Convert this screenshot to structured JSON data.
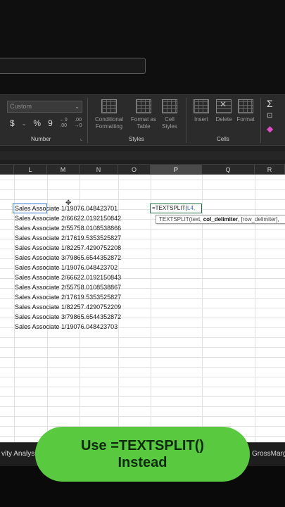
{
  "ribbon": {
    "number_format_value": "Custom",
    "number_buttons": [
      "$",
      "%",
      "9"
    ],
    "groups": {
      "number": "Number",
      "styles": "Styles",
      "cells": "Cells"
    },
    "buttons": {
      "conditional_formatting": [
        "Conditional",
        "Formatting"
      ],
      "format_as_table": [
        "Format as",
        "Table"
      ],
      "cell_styles": [
        "Cell",
        "Styles"
      ],
      "insert": "Insert",
      "delete": "Delete",
      "format": "Format"
    }
  },
  "columns": [
    "L",
    "M",
    "N",
    "O",
    "P",
    "Q",
    "R"
  ],
  "active_column": "P",
  "rows": [
    "Sales Associate 1/19076.048423701",
    "Sales Associate 2/66622.0192150842",
    "Sales Associate 2/55758.0108538866",
    "Sales Associate 2/17619.5353525827",
    "Sales Associate 1/82257.4290752208",
    "Sales Associate 3/79865.6544352872",
    "Sales Associate 1/19076.048423702",
    "Sales Associate 2/66622.0192150843",
    "Sales Associate 2/55758.0108538867",
    "Sales Associate 2/17619.5353525827",
    "Sales Associate 1/82257.4290752209",
    "Sales Associate 3/79865.6544352872",
    "Sales Associate 1/19076.048423703"
  ],
  "formula": {
    "prefix": "=TEXTSPLIT(",
    "ref": "L4,"
  },
  "tooltip": {
    "before": "TEXTSPLIT(text, ",
    "bold": "col_delimiter",
    "after": ", [row_delimiter],"
  },
  "sheet_tabs": {
    "left": "vity Analysi",
    "right": "GrossMarg"
  },
  "overlay": {
    "line1": "Use =TEXTSPLIT()",
    "line2": "Instead"
  }
}
